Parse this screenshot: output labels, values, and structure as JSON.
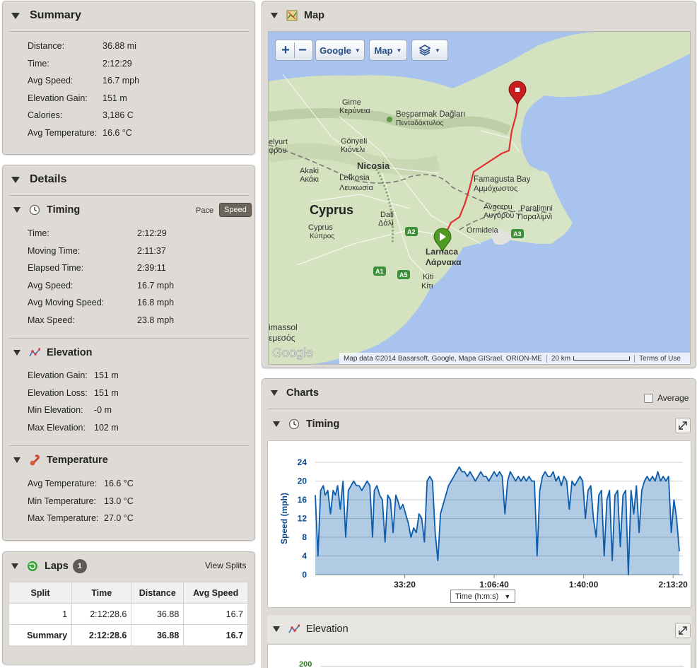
{
  "summary": {
    "title": "Summary",
    "rows": [
      {
        "label": "Distance:",
        "value": "36.88 mi"
      },
      {
        "label": "Time:",
        "value": "2:12:29"
      },
      {
        "label": "Avg Speed:",
        "value": "16.7 mph"
      },
      {
        "label": "Elevation Gain:",
        "value": "151 m"
      },
      {
        "label": "Calories:",
        "value": "3,186 C"
      },
      {
        "label": "Avg Temperature:",
        "value": "16.6 °C"
      }
    ]
  },
  "details": {
    "title": "Details",
    "timing": {
      "title": "Timing",
      "pace_label": "Pace",
      "speed_label": "Speed",
      "rows": [
        {
          "label": "Time:",
          "value": "2:12:29"
        },
        {
          "label": "Moving Time:",
          "value": "2:11:37"
        },
        {
          "label": "Elapsed Time:",
          "value": "2:39:11"
        },
        {
          "label": "Avg Speed:",
          "value": "16.7 mph"
        },
        {
          "label": "Avg Moving Speed:",
          "value": "16.8 mph"
        },
        {
          "label": "Max Speed:",
          "value": "23.8 mph"
        }
      ]
    },
    "elevation": {
      "title": "Elevation",
      "rows": [
        {
          "label": "Elevation Gain:",
          "value": "151 m"
        },
        {
          "label": "Elevation Loss:",
          "value": "151 m"
        },
        {
          "label": "Min Elevation:",
          "value": "-0 m"
        },
        {
          "label": "Max Elevation:",
          "value": "102 m"
        }
      ]
    },
    "temperature": {
      "title": "Temperature",
      "rows": [
        {
          "label": "Avg Temperature:",
          "value": "16.6 °C"
        },
        {
          "label": "Min Temperature:",
          "value": "13.0 °C"
        },
        {
          "label": "Max Temperature:",
          "value": "27.0 °C"
        }
      ]
    }
  },
  "laps": {
    "title": "Laps",
    "count": "1",
    "view_splits": "View Splits",
    "headers": [
      "Split",
      "Time",
      "Distance",
      "Avg Speed"
    ],
    "rows": [
      [
        "1",
        "2:12:28.6",
        "36.88",
        "16.7"
      ],
      [
        "Summary",
        "2:12:28.6",
        "36.88",
        "16.7"
      ]
    ]
  },
  "map": {
    "title": "Map",
    "zoom_in": "+",
    "zoom_out": "−",
    "provider": "Google",
    "type": "Map",
    "labels": {
      "cyprus": "Cyprus",
      "cyprus_small": "Cyprus",
      "cyprus_greek": "Κύπρος",
      "nicosia": "Nicosia",
      "lefkosia": "Lefkosia",
      "lefkosia_gr": "Λευκωσία",
      "kyrenia": "Girne",
      "kyrenia_gr": "Κερύνεια",
      "besparmak": "Beşparmak Dağları",
      "besparmak_gr": "Πενταδάκτυλος",
      "famagusta": "Famagusta Bay",
      "famagusta_gr": "Αμμόχωστος",
      "larnaca": "Larnaca",
      "larnaca_gr": "Λάρνακα",
      "dali": "Dali",
      "dali_gr": "Δάλι",
      "kiti": "Kiti",
      "kiti_gr": "Κίτι",
      "akaki": "Akaki",
      "akaki_gr": "Ακάκι",
      "gonyeli": "Gönyeli",
      "gonyeli_gr": "Κιόνελι",
      "avgorou": "Avgorou",
      "avgorou_gr": "Αυγόρου",
      "paralimni": "Paralimni",
      "paralimni_gr": "Παραλίμνι",
      "ormideia": "Ormideia",
      "limassol": "imassol",
      "limassol_gr": "εμεσός",
      "elyurt": "elyurt",
      "elyurt_gr": "φρου",
      "a1": "A1",
      "a2": "A2",
      "a3": "A3",
      "a5": "A5"
    },
    "logo": "Google",
    "attribution": "Map data ©2014 Basarsoft, Google, Mapa GISrael, ORION-ME",
    "scale": "20 km",
    "terms": "Terms of Use",
    "route_color": "#e03030"
  },
  "charts": {
    "title": "Charts",
    "average_label": "Average",
    "timing_title": "Timing",
    "elevation_title": "Elevation",
    "time_select": "Time (h:m:s)",
    "elev_first_tick": "200"
  },
  "chart_data": {
    "type": "area",
    "ylabel": "Speed (mph)",
    "xlabel": "",
    "ylim": [
      0,
      24
    ],
    "yticks": [
      "0",
      "4",
      "8",
      "12",
      "16",
      "20",
      "24"
    ],
    "xticks": [
      "33:20",
      "1:06:40",
      "1:40:00",
      "2:13:20"
    ],
    "xtick_seconds": [
      2000,
      4000,
      6000,
      8000
    ],
    "xlim_seconds": [
      0,
      8140
    ],
    "series": [
      {
        "color": "#0b5cad",
        "x": [
          0,
          60,
          120,
          180,
          220,
          280,
          340,
          400,
          450,
          500,
          560,
          620,
          680,
          740,
          800,
          860,
          920,
          980,
          1040,
          1100,
          1160,
          1220,
          1280,
          1320,
          1380,
          1440,
          1500,
          1560,
          1620,
          1680,
          1740,
          1800,
          1840,
          1900,
          1960,
          2020,
          2080,
          2140,
          2200,
          2260,
          2320,
          2380,
          2440,
          2500,
          2560,
          2620,
          2680,
          2740,
          2800,
          2860,
          2920,
          2980,
          3040,
          3100,
          3160,
          3220,
          3280,
          3340,
          3400,
          3460,
          3520,
          3580,
          3640,
          3700,
          3760,
          3820,
          3880,
          3940,
          4000,
          4060,
          4120,
          4180,
          4240,
          4300,
          4360,
          4420,
          4480,
          4540,
          4600,
          4660,
          4720,
          4780,
          4840,
          4900,
          4960,
          5020,
          5080,
          5140,
          5200,
          5260,
          5320,
          5380,
          5440,
          5500,
          5560,
          5620,
          5680,
          5740,
          5800,
          5860,
          5920,
          5980,
          6040,
          6100,
          6160,
          6220,
          6280,
          6340,
          6400,
          6460,
          6520,
          6580,
          6640,
          6700,
          6760,
          6820,
          6880,
          6940,
          7000,
          7060,
          7120,
          7180,
          7240,
          7300,
          7360,
          7420,
          7480,
          7540,
          7600,
          7660,
          7720,
          7780,
          7840,
          7900,
          7960,
          8020,
          8080,
          8140
        ],
        "y": [
          17,
          4,
          18,
          19,
          17,
          18,
          13,
          18,
          17,
          19,
          14,
          20,
          8,
          18,
          19,
          20,
          19,
          19,
          18,
          19,
          20,
          19,
          8,
          18,
          19,
          17,
          16,
          7,
          17,
          16,
          9,
          17,
          16,
          14,
          15,
          13,
          11,
          8,
          10,
          9,
          13,
          12,
          7,
          20,
          21,
          20,
          9,
          3,
          13,
          15,
          17,
          19,
          20,
          21,
          22,
          23,
          22,
          22,
          21,
          22,
          21,
          20,
          21,
          22,
          21,
          21,
          20,
          21,
          22,
          21,
          22,
          21,
          13,
          20,
          22,
          21,
          20,
          21,
          20,
          21,
          20,
          21,
          20,
          20,
          4,
          18,
          21,
          22,
          21,
          21,
          22,
          20,
          21,
          19,
          21,
          20,
          14,
          20,
          19,
          20,
          21,
          20,
          12,
          18,
          19,
          12,
          8,
          17,
          18,
          4,
          16,
          18,
          3,
          17,
          18,
          6,
          17,
          18,
          0,
          18,
          13,
          19,
          9,
          18,
          20,
          21,
          20,
          21,
          20,
          22,
          20,
          21,
          20,
          21,
          9,
          16,
          12,
          5
        ]
      }
    ]
  }
}
